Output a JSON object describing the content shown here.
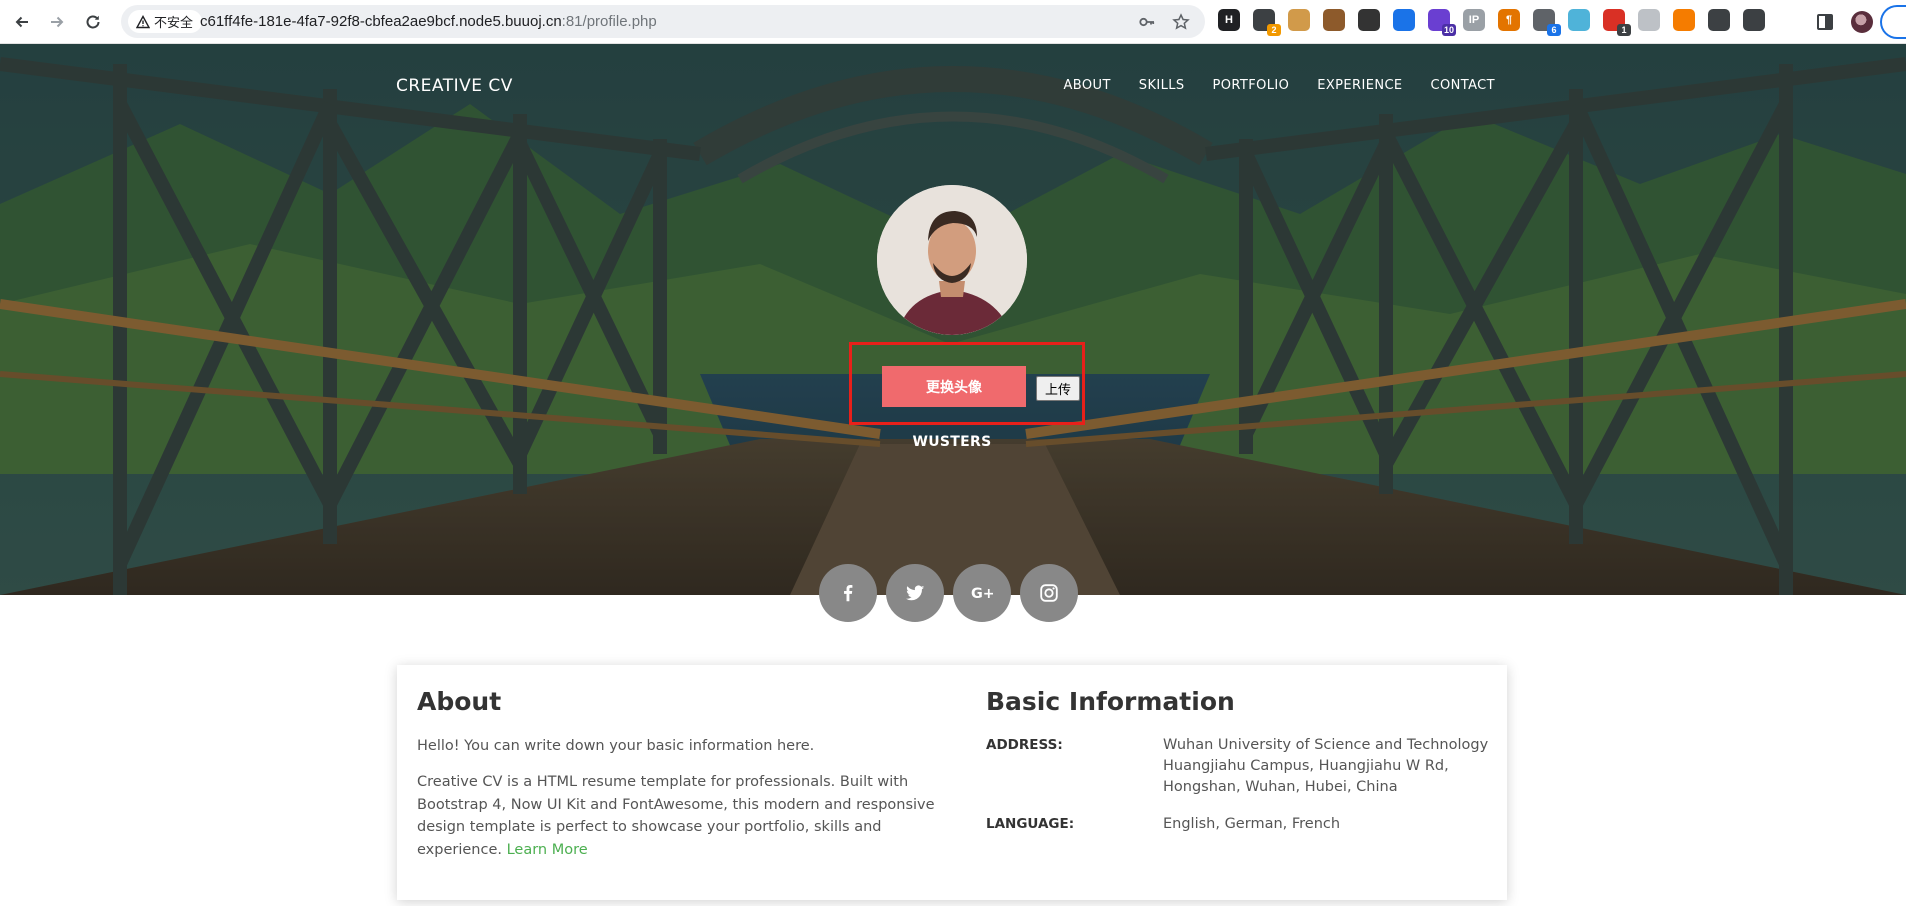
{
  "browser": {
    "security_label": "不安全",
    "url_host": "c61ff4fe-181e-4fa7-92f8-cbfea2ae9bcf.node5.buuoj.cn",
    "url_path": ":81/profile.php",
    "extensions": [
      {
        "name": "hackbar-extension-icon",
        "label": "H",
        "color": "#202124",
        "badge": ""
      },
      {
        "name": "extension-icon-2",
        "label": "",
        "color": "#3c4043",
        "badge": "2",
        "badge_color": "#f29900"
      },
      {
        "name": "cookie-extension-icon",
        "label": "",
        "color": "#d19a4a",
        "badge": ""
      },
      {
        "name": "cookie-editor-icon",
        "label": "",
        "color": "#8d5a2b",
        "badge": ""
      },
      {
        "name": "hat-extension-icon",
        "label": "",
        "color": "#333",
        "badge": ""
      },
      {
        "name": "pin-extension-icon",
        "label": "",
        "color": "#1a73e8",
        "badge": ""
      },
      {
        "name": "extension-icon-10",
        "label": "",
        "color": "#6a3fd1",
        "badge": "10",
        "badge_color": "#4b2fa6"
      },
      {
        "name": "ip-extension-icon",
        "label": "IP",
        "color": "#9aa0a6",
        "badge": ""
      },
      {
        "name": "wappalyzer-icon",
        "label": "¶",
        "color": "#e37400",
        "badge": ""
      },
      {
        "name": "extension-icon-6",
        "label": "",
        "color": "#5f6368",
        "badge": "6",
        "badge_color": "#1a73e8"
      },
      {
        "name": "trophy-extension-icon",
        "label": "",
        "color": "#4fb3d9",
        "badge": ""
      },
      {
        "name": "extension-icon-1",
        "label": "",
        "color": "#d93025",
        "badge": "1",
        "badge_color": "#3c4043"
      },
      {
        "name": "moon-extension-icon",
        "label": "",
        "color": "#bdc1c6",
        "badge": ""
      },
      {
        "name": "dark-reader-icon",
        "label": "",
        "color": "#f57c00",
        "badge": ""
      },
      {
        "name": "spy-extension-icon",
        "label": "",
        "color": "#3c4043",
        "badge": ""
      },
      {
        "name": "puzzle-extensions-icon",
        "label": "",
        "color": "#3c4043",
        "badge": ""
      }
    ]
  },
  "site": {
    "brand": "CREATIVE CV",
    "nav": [
      "ABOUT",
      "SKILLS",
      "PORTFOLIO",
      "EXPERIENCE",
      "CONTACT"
    ],
    "change_avatar_label": "更换头像",
    "upload_label": "上传",
    "username": "WUSTERS",
    "social": [
      "facebook-icon",
      "twitter-icon",
      "google-plus-icon",
      "instagram-icon"
    ]
  },
  "about": {
    "title": "About",
    "intro": "Hello! You can write down your basic information here.",
    "body": "Creative CV is a HTML resume template for professionals. Built with Bootstrap 4, Now UI Kit and FontAwesome, this modern and responsive design template is perfect to showcase your portfolio, skills and experience.",
    "learn_more": "Learn More"
  },
  "basic_info": {
    "title": "Basic Information",
    "address_label": "ADDRESS:",
    "address_value": "Wuhan University of Science and Technology Huangjiahu Campus, Huangjiahu W Rd, Hongshan, Wuhan, Hubei, China",
    "language_label": "LANGUAGE:",
    "language_value": "English, German, French"
  },
  "colors": {
    "accent_button": "#f06a6d",
    "highlight_box": "#e8201a",
    "link": "#4caf50",
    "social_bg": "#888888"
  }
}
